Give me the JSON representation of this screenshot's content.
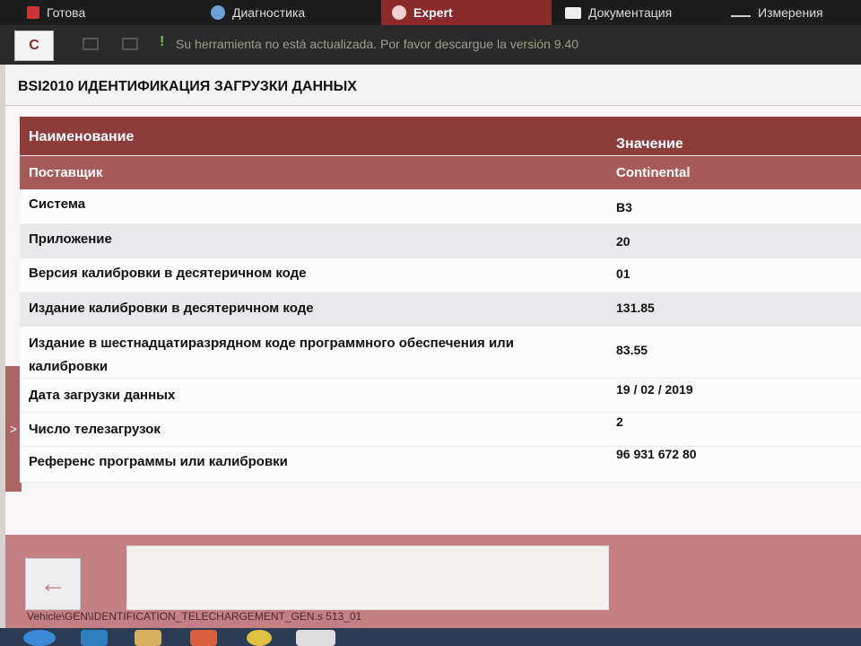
{
  "topbar": {
    "prev_label": "Готова",
    "diagnostics_label": "Диагностика",
    "expert_label": "Expert",
    "docs_label": "Документация",
    "measure_label": "Измерения"
  },
  "logo": {
    "brand": "C"
  },
  "notice": {
    "icon": "!",
    "text": "Su herramienta no está actualizada. Por favor descargue la versión 9.40"
  },
  "title": "BSI2010 ИДЕНТИФИКАЦИЯ ЗАГРУЗКИ ДАННЫХ",
  "table": {
    "header": {
      "name": "Наименование",
      "value": "Значение"
    },
    "rows": [
      {
        "name": "Поставщик",
        "value": "Continental"
      },
      {
        "name": "Система",
        "value": "B3"
      },
      {
        "name": "Приложение",
        "value": "20"
      },
      {
        "name": "Версия калибровки в десятеричном коде",
        "value": "01"
      },
      {
        "name": "Издание калибровки в десятеричном коде",
        "value": "131.85"
      },
      {
        "name": "Издание в шестнадцатиразрядном коде программного обеспечения или калибровки",
        "value": "83.55"
      },
      {
        "name": "Дата загрузки данных",
        "value": "19 / 02 / 2019"
      },
      {
        "name": "Число телезагрузок",
        "value": "2"
      },
      {
        "name": "Референс программы или калибровки",
        "value": "96 931 672 80"
      }
    ]
  },
  "left_tab": {
    "icon": ">"
  },
  "bottom": {
    "back_icon": "arrow-left-icon",
    "path": "Vehicle\\GEN\\IDENTIFICATION_TELECHARGEMENT_GEN.s 513_01"
  }
}
